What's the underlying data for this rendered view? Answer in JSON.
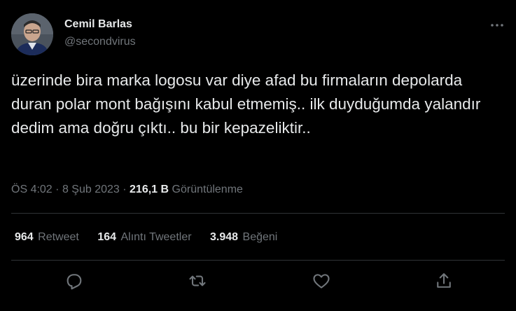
{
  "author": {
    "display_name": "Cemil Barlas",
    "handle": "@secondvirus",
    "avatar_icon": "profile-photo"
  },
  "tweet": {
    "text": "üzerinde bira marka logosu var diye afad bu firmaların depolarda duran polar mont bağışını kabul etmemiş.. ilk duyduğumda yalandır dedim ama doğru çıktı.. bu bir kepazeliktir.."
  },
  "meta": {
    "time": "ÖS 4:02",
    "separator": "·",
    "date": "8 Şub 2023",
    "views_count": "216,1 B",
    "views_label": "Görüntülenme"
  },
  "stats": {
    "retweets": {
      "count": "964",
      "label": "Retweet"
    },
    "quotes": {
      "count": "164",
      "label": "Alıntı Tweetler"
    },
    "likes": {
      "count": "3.948",
      "label": "Beğeni"
    }
  },
  "actions": [
    {
      "name": "reply",
      "icon": "reply-icon"
    },
    {
      "name": "retweet",
      "icon": "retweet-icon"
    },
    {
      "name": "like",
      "icon": "heart-icon"
    },
    {
      "name": "share",
      "icon": "share-icon"
    }
  ],
  "colors": {
    "background": "#000000",
    "text_primary": "#e7e9ea",
    "text_secondary": "#71767b",
    "divider": "#2f3336"
  }
}
